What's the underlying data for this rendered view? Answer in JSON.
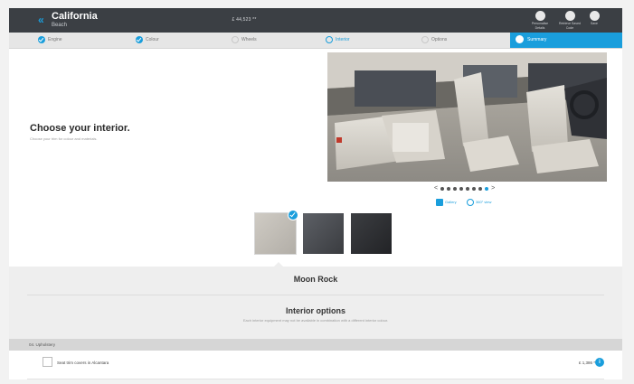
{
  "header": {
    "back_glyph": "«",
    "model": "California",
    "model_variant": "Beach",
    "price": "£ 44,523 **",
    "actions": [
      {
        "icon": "pencil-icon",
        "label_line1": "Personalise",
        "label_line2": "Details"
      },
      {
        "icon": "save-icon",
        "label_line1": "Retrieve Saved",
        "label_line2": "Code"
      },
      {
        "icon": "save-icon",
        "label_line1": "Save",
        "label_line2": ""
      }
    ]
  },
  "steps": [
    {
      "label": "Engine",
      "state": "done"
    },
    {
      "label": "Colour",
      "state": "done"
    },
    {
      "label": "Wheels",
      "state": "pending"
    },
    {
      "label": "Interior",
      "state": "active"
    },
    {
      "label": "Options",
      "state": "pending"
    },
    {
      "label": "Summary",
      "state": "summary"
    }
  ],
  "main": {
    "title": "Choose your interior.",
    "subtitle": "Choose your trim for colour and materials."
  },
  "pager": {
    "prev": "<",
    "next": ">",
    "count": 8,
    "active_index": 7
  },
  "gallery_links": [
    {
      "icon": "gallery-icon",
      "label": "Gallery"
    },
    {
      "icon": "view-360-icon",
      "label": "360° view"
    }
  ],
  "swatches": [
    {
      "name": "Moon Rock",
      "selected": true
    },
    {
      "name": "",
      "selected": false
    },
    {
      "name": "",
      "selected": false
    }
  ],
  "selected_colour": "Moon Rock",
  "interior_options": {
    "title": "Interior options",
    "subtitle": "Each interior equipment may not be available in combination with a different interior colour."
  },
  "section": {
    "label": "04. Upholstery"
  },
  "option_rows": [
    {
      "label": "Seat trim covers in Alcantara",
      "price": "£ 1,386 **",
      "checked": false,
      "info": "i"
    }
  ],
  "colors": {
    "accent": "#1a9edc",
    "header_bg": "#3b3f44"
  }
}
